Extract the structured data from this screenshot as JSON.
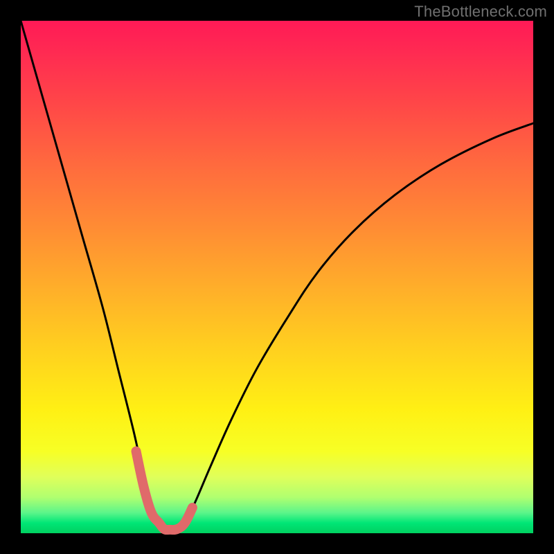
{
  "watermark": "TheBottleneck.com",
  "chart_data": {
    "type": "line",
    "title": "",
    "xlabel": "",
    "ylabel": "",
    "xlim": [
      0,
      100
    ],
    "ylim": [
      0,
      100
    ],
    "series": [
      {
        "name": "bottleneck-curve",
        "x": [
          0,
          4,
          8,
          12,
          16,
          19,
          22,
          24,
          25.5,
          27,
          28,
          29,
          30.5,
          32,
          34,
          37,
          41,
          46,
          52,
          58,
          65,
          73,
          82,
          92,
          100
        ],
        "values": [
          100,
          86,
          72,
          58,
          44,
          32,
          20,
          11,
          5,
          2,
          0.8,
          0.7,
          0.8,
          2,
          6,
          13,
          22,
          32,
          42,
          51,
          59,
          66,
          72,
          77,
          80
        ]
      },
      {
        "name": "highlight-segment",
        "x": [
          22.5,
          24,
          25.5,
          27,
          28,
          29,
          30.5,
          32,
          33.5
        ],
        "values": [
          16,
          9,
          4,
          2,
          0.8,
          0.7,
          0.8,
          2,
          5
        ]
      }
    ],
    "colors": {
      "curve": "#000000",
      "highlight": "#e06a6a",
      "gradient_top": "#ff1a56",
      "gradient_bottom": "#00d060"
    }
  }
}
